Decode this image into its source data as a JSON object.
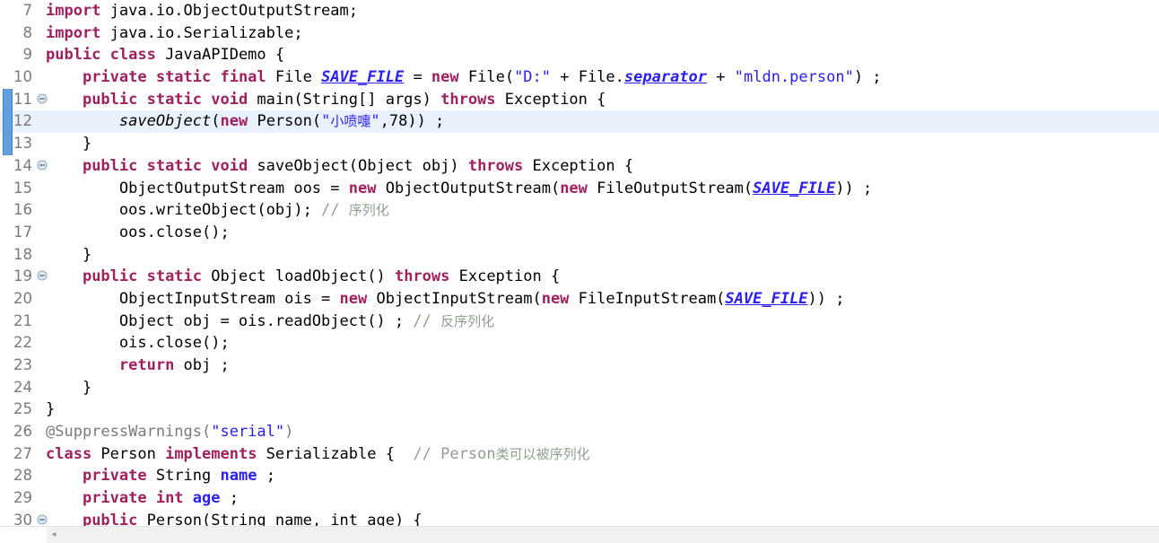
{
  "editor": {
    "name": "java-source-editor",
    "language": "Java",
    "font_size_px": 17,
    "line_height_px": 24.7,
    "first_visible_line": 7,
    "last_visible_line": 30,
    "highlighted_line": 12,
    "change_bar_lines": [
      11,
      12,
      13
    ],
    "fold_marker_lines": [
      11,
      14,
      19,
      30
    ],
    "colors": {
      "background": "#ffffff",
      "keyword": "#a0215f",
      "string": "#2a20f0",
      "comment": "#8fa08f",
      "static_field": "#2a20f0",
      "line_number": "#7a7a7a",
      "current_line_highlight": "#e9f1fc",
      "change_bar": "#60a0e0",
      "scrollbar_track": "#f1f1f1"
    }
  },
  "scrollbar": {
    "name": "horizontal-scrollbar",
    "left_arrow_glyph": "◂"
  },
  "lines": [
    {
      "n": "7",
      "fold": false,
      "hl": false,
      "tokens": [
        {
          "t": "import",
          "c": "kw"
        },
        {
          "t": " java.io.ObjectOutputStream;",
          "c": "plain"
        }
      ]
    },
    {
      "n": "8",
      "fold": false,
      "hl": false,
      "tokens": [
        {
          "t": "import",
          "c": "kw"
        },
        {
          "t": " java.io.Serializable;",
          "c": "plain"
        }
      ]
    },
    {
      "n": "9",
      "fold": false,
      "hl": false,
      "tokens": [
        {
          "t": "public class",
          "c": "kw"
        },
        {
          "t": " JavaAPIDemo {",
          "c": "plain"
        }
      ]
    },
    {
      "n": "10",
      "fold": false,
      "hl": false,
      "tokens": [
        {
          "t": "    ",
          "c": "plain"
        },
        {
          "t": "private static final",
          "c": "kw"
        },
        {
          "t": " File ",
          "c": "plain"
        },
        {
          "t": "SAVE_FILE",
          "c": "fld"
        },
        {
          "t": " = ",
          "c": "plain"
        },
        {
          "t": "new",
          "c": "kw"
        },
        {
          "t": " File(",
          "c": "plain"
        },
        {
          "t": "\"D:\"",
          "c": "str"
        },
        {
          "t": " + File.",
          "c": "plain"
        },
        {
          "t": "separator",
          "c": "fld"
        },
        {
          "t": " + ",
          "c": "plain"
        },
        {
          "t": "\"mldn.person\"",
          "c": "str"
        },
        {
          "t": ") ;",
          "c": "plain"
        }
      ]
    },
    {
      "n": "11",
      "fold": true,
      "hl": false,
      "tokens": [
        {
          "t": "    ",
          "c": "plain"
        },
        {
          "t": "public static void",
          "c": "kw"
        },
        {
          "t": " main(String[] args) ",
          "c": "plain"
        },
        {
          "t": "throws",
          "c": "kw"
        },
        {
          "t": " Exception {",
          "c": "plain"
        }
      ]
    },
    {
      "n": "12",
      "fold": false,
      "hl": true,
      "tokens": [
        {
          "t": "        ",
          "c": "plain"
        },
        {
          "t": "saveObject",
          "c": "mth"
        },
        {
          "t": "(",
          "c": "plain"
        },
        {
          "t": "new",
          "c": "kw"
        },
        {
          "t": " Person(",
          "c": "plain"
        },
        {
          "t": "\"",
          "c": "str"
        },
        {
          "t": "小喷嚏",
          "c": "cn"
        },
        {
          "t": "\"",
          "c": "str"
        },
        {
          "t": ",78)) ;",
          "c": "plain"
        }
      ]
    },
    {
      "n": "13",
      "fold": false,
      "hl": false,
      "tokens": [
        {
          "t": "    }",
          "c": "plain"
        }
      ]
    },
    {
      "n": "14",
      "fold": true,
      "hl": false,
      "tokens": [
        {
          "t": "    ",
          "c": "plain"
        },
        {
          "t": "public static void",
          "c": "kw"
        },
        {
          "t": " saveObject(Object obj) ",
          "c": "plain"
        },
        {
          "t": "throws",
          "c": "kw"
        },
        {
          "t": " Exception {",
          "c": "plain"
        }
      ]
    },
    {
      "n": "15",
      "fold": false,
      "hl": false,
      "tokens": [
        {
          "t": "        ObjectOutputStream oos = ",
          "c": "plain"
        },
        {
          "t": "new",
          "c": "kw"
        },
        {
          "t": " ObjectOutputStream(",
          "c": "plain"
        },
        {
          "t": "new",
          "c": "kw"
        },
        {
          "t": " FileOutputStream(",
          "c": "plain"
        },
        {
          "t": "SAVE_FILE",
          "c": "fld"
        },
        {
          "t": ")) ;",
          "c": "plain"
        }
      ]
    },
    {
      "n": "16",
      "fold": false,
      "hl": false,
      "tokens": [
        {
          "t": "        oos.writeObject(obj); ",
          "c": "plain"
        },
        {
          "t": "// ",
          "c": "cmt"
        },
        {
          "t": "序列化",
          "c": "cmt-cn"
        }
      ]
    },
    {
      "n": "17",
      "fold": false,
      "hl": false,
      "tokens": [
        {
          "t": "        oos.close();",
          "c": "plain"
        }
      ]
    },
    {
      "n": "18",
      "fold": false,
      "hl": false,
      "tokens": [
        {
          "t": "    }",
          "c": "plain"
        }
      ]
    },
    {
      "n": "19",
      "fold": true,
      "hl": false,
      "tokens": [
        {
          "t": "    ",
          "c": "plain"
        },
        {
          "t": "public static",
          "c": "kw"
        },
        {
          "t": " Object loadObject() ",
          "c": "plain"
        },
        {
          "t": "throws",
          "c": "kw"
        },
        {
          "t": " Exception {",
          "c": "plain"
        }
      ]
    },
    {
      "n": "20",
      "fold": false,
      "hl": false,
      "tokens": [
        {
          "t": "        ObjectInputStream ois = ",
          "c": "plain"
        },
        {
          "t": "new",
          "c": "kw"
        },
        {
          "t": " ObjectInputStream(",
          "c": "plain"
        },
        {
          "t": "new",
          "c": "kw"
        },
        {
          "t": " FileInputStream(",
          "c": "plain"
        },
        {
          "t": "SAVE_FILE",
          "c": "fld"
        },
        {
          "t": ")) ;",
          "c": "plain"
        }
      ]
    },
    {
      "n": "21",
      "fold": false,
      "hl": false,
      "tokens": [
        {
          "t": "        Object obj = ois.readObject() ; ",
          "c": "plain"
        },
        {
          "t": "// ",
          "c": "cmt"
        },
        {
          "t": "反序列化",
          "c": "cmt-cn"
        }
      ]
    },
    {
      "n": "22",
      "fold": false,
      "hl": false,
      "tokens": [
        {
          "t": "        ois.close();",
          "c": "plain"
        }
      ]
    },
    {
      "n": "23",
      "fold": false,
      "hl": false,
      "tokens": [
        {
          "t": "        ",
          "c": "plain"
        },
        {
          "t": "return",
          "c": "kw"
        },
        {
          "t": " obj ;",
          "c": "plain"
        }
      ]
    },
    {
      "n": "24",
      "fold": false,
      "hl": false,
      "tokens": [
        {
          "t": "    }",
          "c": "plain"
        }
      ]
    },
    {
      "n": "25",
      "fold": false,
      "hl": false,
      "tokens": [
        {
          "t": "}",
          "c": "plain"
        }
      ]
    },
    {
      "n": "26",
      "fold": false,
      "hl": false,
      "tokens": [
        {
          "t": "@SuppressWarnings(",
          "c": "ann"
        },
        {
          "t": "\"serial\"",
          "c": "str"
        },
        {
          "t": ")",
          "c": "ann"
        }
      ]
    },
    {
      "n": "27",
      "fold": false,
      "hl": false,
      "tokens": [
        {
          "t": "class",
          "c": "kw"
        },
        {
          "t": " Person ",
          "c": "plain"
        },
        {
          "t": "implements",
          "c": "kw"
        },
        {
          "t": " Serializable {  ",
          "c": "plain"
        },
        {
          "t": "// Person",
          "c": "cmt"
        },
        {
          "t": "类可以被序列化",
          "c": "cmt-cn"
        }
      ]
    },
    {
      "n": "28",
      "fold": false,
      "hl": false,
      "tokens": [
        {
          "t": "    ",
          "c": "plain"
        },
        {
          "t": "private",
          "c": "kw"
        },
        {
          "t": " String ",
          "c": "plain"
        },
        {
          "t": "name",
          "c": "fldn"
        },
        {
          "t": " ;",
          "c": "plain"
        }
      ]
    },
    {
      "n": "29",
      "fold": false,
      "hl": false,
      "tokens": [
        {
          "t": "    ",
          "c": "plain"
        },
        {
          "t": "private int",
          "c": "kw"
        },
        {
          "t": " ",
          "c": "plain"
        },
        {
          "t": "age",
          "c": "fldn"
        },
        {
          "t": " ;",
          "c": "plain"
        }
      ]
    },
    {
      "n": "30",
      "fold": true,
      "hl": false,
      "tokens": [
        {
          "t": "    ",
          "c": "plain"
        },
        {
          "t": "public",
          "c": "kw"
        },
        {
          "t": " Person(String name, int age) {",
          "c": "plain"
        }
      ]
    }
  ]
}
